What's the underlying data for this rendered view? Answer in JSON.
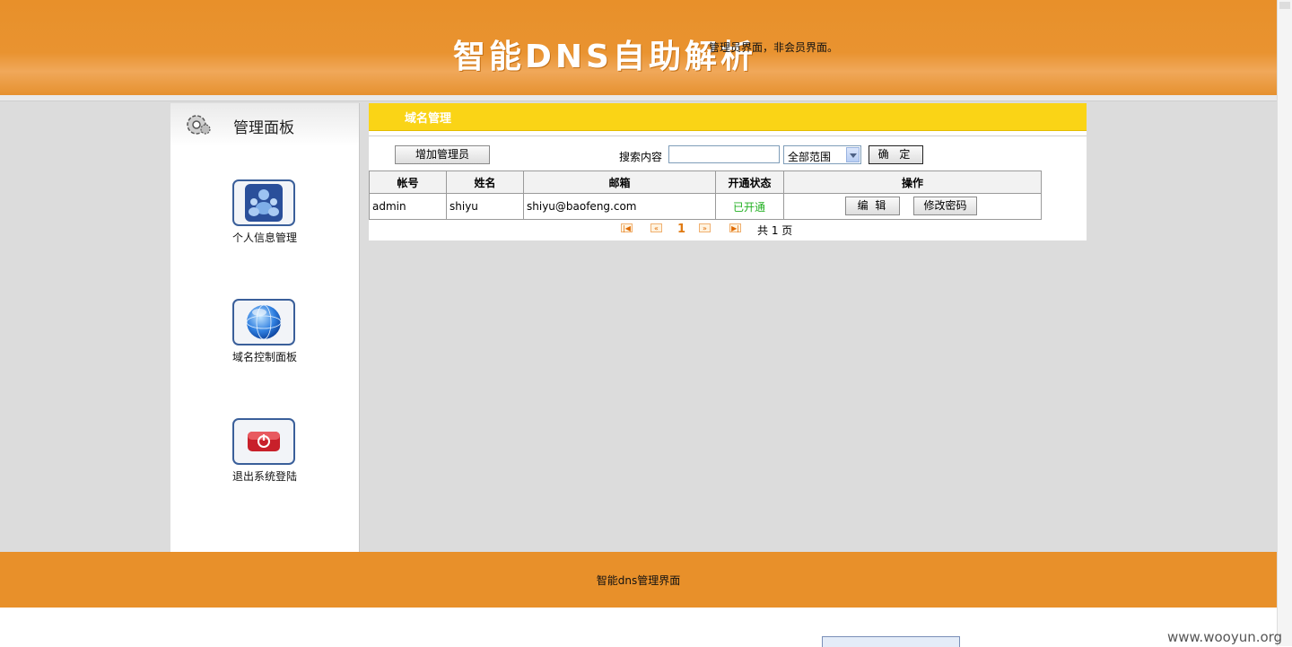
{
  "header": {
    "title": "智能DNS自助解析",
    "subtitle": "管理员界面，非会员界面。"
  },
  "sidebar": {
    "title": "管理面板",
    "items": [
      {
        "label": "个人信息管理",
        "icon": "users-icon"
      },
      {
        "label": "域名控制面板",
        "icon": "globe-icon"
      },
      {
        "label": "退出系统登陆",
        "icon": "power-icon"
      }
    ]
  },
  "panel": {
    "title": "域名管理",
    "add_button": "增加管理员",
    "search_label": "搜索内容",
    "search_value": "",
    "scope_selected": "全部范围",
    "confirm_button": "确 定",
    "table": {
      "headers": [
        "帐号",
        "姓名",
        "邮箱",
        "开通状态",
        "操作"
      ],
      "rows": [
        {
          "account": "admin",
          "name": "shiyu",
          "email": "shiyu@baofeng.com",
          "status": "已开通",
          "edit": "编 辑",
          "change_password": "修改密码"
        }
      ]
    },
    "pager": {
      "current": "1",
      "total": "共 1 页"
    }
  },
  "footer": {
    "text": "智能dns管理界面"
  },
  "watermark": "www.wooyun.org",
  "colors": {
    "header": "#e8902a",
    "panel_head": "#fad416",
    "status_ok": "#22b022"
  }
}
